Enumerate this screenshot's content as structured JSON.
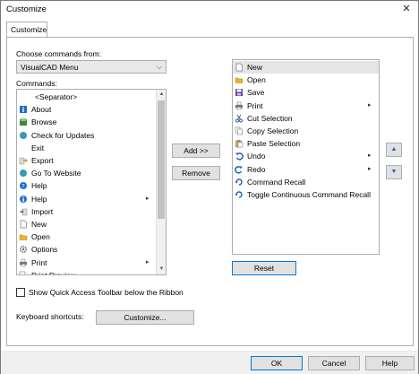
{
  "window": {
    "title": "Customize",
    "close_glyph": "✕"
  },
  "tabs": [
    {
      "label": "Customize"
    }
  ],
  "choose": {
    "label": "Choose commands from:",
    "selected": "VisualCAD Menu"
  },
  "commands": {
    "label": "Commands:",
    "items": [
      {
        "label": "<Separator>",
        "icon": "none"
      },
      {
        "label": "About",
        "icon": "about-icon"
      },
      {
        "label": "Browse",
        "icon": "browse-icon"
      },
      {
        "label": "Check for Updates",
        "icon": "globe-icon"
      },
      {
        "label": "Exit",
        "icon": "none"
      },
      {
        "label": "Export",
        "icon": "export-icon"
      },
      {
        "label": "Go To Website",
        "icon": "globe-icon"
      },
      {
        "label": "Help",
        "icon": "help-icon"
      },
      {
        "label": "Help",
        "icon": "info-icon",
        "submenu": true
      },
      {
        "label": "Import",
        "icon": "import-icon"
      },
      {
        "label": "New",
        "icon": "new-document-icon"
      },
      {
        "label": "Open",
        "icon": "open-folder-icon"
      },
      {
        "label": "Options",
        "icon": "gear-icon"
      },
      {
        "label": "Print",
        "icon": "printer-icon",
        "submenu": true
      },
      {
        "label": "Print Preview",
        "icon": "print-preview-icon"
      }
    ]
  },
  "toolbar": {
    "items": [
      {
        "label": "New",
        "icon": "new-document-icon"
      },
      {
        "label": "Open",
        "icon": "open-folder-icon"
      },
      {
        "label": "Save",
        "icon": "save-icon"
      },
      {
        "label": "Print",
        "icon": "printer-icon",
        "submenu": true
      },
      {
        "label": "Cut Selection",
        "icon": "scissors-icon"
      },
      {
        "label": "Copy Selection",
        "icon": "copy-icon"
      },
      {
        "label": "Paste Selection",
        "icon": "paste-icon"
      },
      {
        "label": "Undo",
        "icon": "undo-icon",
        "submenu": true
      },
      {
        "label": "Redo",
        "icon": "redo-icon",
        "submenu": true
      },
      {
        "label": "Command Recall",
        "icon": "recall-icon"
      },
      {
        "label": "Toggle Continuous Command Recall",
        "icon": "recall-icon"
      }
    ]
  },
  "buttons": {
    "add": "Add >>",
    "remove": "Remove",
    "reset": "Reset",
    "move_up_glyph": "▲",
    "move_down_glyph": "▼",
    "customize": "Customize...",
    "ok": "OK",
    "cancel": "Cancel",
    "help": "Help"
  },
  "qat": {
    "label": "Show Quick Access Toolbar below the Ribbon",
    "checked": false
  },
  "keyboard": {
    "label": "Keyboard shortcuts:"
  },
  "glyphs": {
    "submenu_arrow": "▸",
    "dropdown_arrow": "⌵",
    "scroll_up": "▲",
    "scroll_down": "▼"
  },
  "colors": {
    "accent": "#0078d7",
    "selection": "#e5e5e5"
  }
}
